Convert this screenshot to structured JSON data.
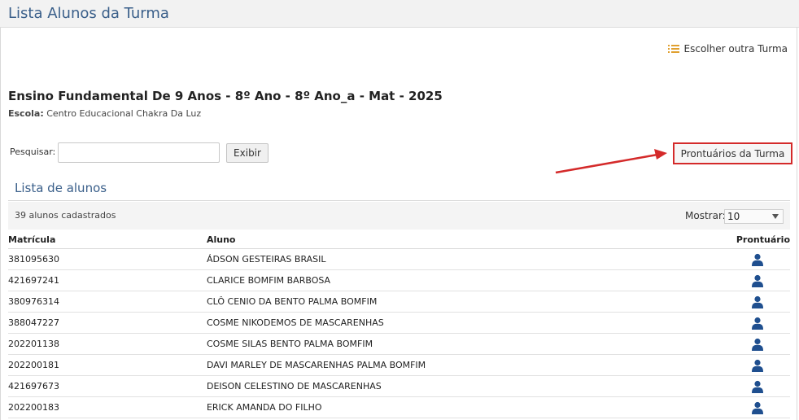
{
  "header": {
    "title": "Lista Alunos da Turma"
  },
  "actions": {
    "choose_class": "Escolher outra Turma",
    "records_button": "Prontuários da Turma"
  },
  "class_info": {
    "title": "Ensino Fundamental De 9 Anos - 8º Ano - 8º Ano_a - Mat - 2025",
    "school_label": "Escola:",
    "school_name": "Centro Educacional Chakra Da Luz"
  },
  "search": {
    "label": "Pesquisar:",
    "value": "",
    "button": "Exibir"
  },
  "students": {
    "section_title": "Lista de alunos",
    "count_text": "39 alunos cadastrados",
    "show_label": "Mostrar:",
    "page_size": "10",
    "columns": [
      "Matrícula",
      "Aluno",
      "Prontuário"
    ],
    "rows": [
      {
        "matricula": "381095630",
        "aluno": "ÁDSON GESTEIRAS BRASIL"
      },
      {
        "matricula": "421697241",
        "aluno": "CLARICE BOMFIM BARBOSA"
      },
      {
        "matricula": "380976314",
        "aluno": "CLÔ CENIO DA BENTO PALMA BOMFIM"
      },
      {
        "matricula": "388047227",
        "aluno": "COSME NIKODEMOS DE MASCARENHAS"
      },
      {
        "matricula": "202201138",
        "aluno": "COSME SILAS BENTO PALMA BOMFIM"
      },
      {
        "matricula": "202200181",
        "aluno": "DAVI MARLEY DE MASCARENHAS PALMA BOMFIM"
      },
      {
        "matricula": "421697673",
        "aluno": "DEISON CELESTINO DE MASCARENHAS"
      },
      {
        "matricula": "202200183",
        "aluno": "ERICK AMANDA DO FILHO"
      }
    ]
  },
  "colors": {
    "title_blue": "#3a5f8a",
    "icon_blue": "#1f4f8f",
    "highlight_red": "#d42a2a",
    "list_icon": "#e0a030"
  },
  "icons": {
    "choose_class": "list-icon",
    "record": "person-icon"
  }
}
